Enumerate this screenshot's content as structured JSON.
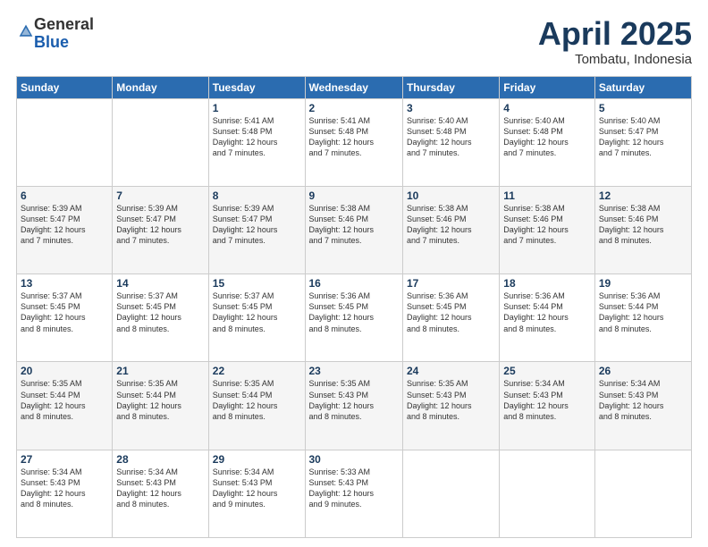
{
  "logo": {
    "general": "General",
    "blue": "Blue"
  },
  "header": {
    "month": "April 2025",
    "location": "Tombatu, Indonesia"
  },
  "weekdays": [
    "Sunday",
    "Monday",
    "Tuesday",
    "Wednesday",
    "Thursday",
    "Friday",
    "Saturday"
  ],
  "weeks": [
    [
      {
        "day": "",
        "detail": ""
      },
      {
        "day": "",
        "detail": ""
      },
      {
        "day": "1",
        "detail": "Sunrise: 5:41 AM\nSunset: 5:48 PM\nDaylight: 12 hours\nand 7 minutes."
      },
      {
        "day": "2",
        "detail": "Sunrise: 5:41 AM\nSunset: 5:48 PM\nDaylight: 12 hours\nand 7 minutes."
      },
      {
        "day": "3",
        "detail": "Sunrise: 5:40 AM\nSunset: 5:48 PM\nDaylight: 12 hours\nand 7 minutes."
      },
      {
        "day": "4",
        "detail": "Sunrise: 5:40 AM\nSunset: 5:48 PM\nDaylight: 12 hours\nand 7 minutes."
      },
      {
        "day": "5",
        "detail": "Sunrise: 5:40 AM\nSunset: 5:47 PM\nDaylight: 12 hours\nand 7 minutes."
      }
    ],
    [
      {
        "day": "6",
        "detail": "Sunrise: 5:39 AM\nSunset: 5:47 PM\nDaylight: 12 hours\nand 7 minutes."
      },
      {
        "day": "7",
        "detail": "Sunrise: 5:39 AM\nSunset: 5:47 PM\nDaylight: 12 hours\nand 7 minutes."
      },
      {
        "day": "8",
        "detail": "Sunrise: 5:39 AM\nSunset: 5:47 PM\nDaylight: 12 hours\nand 7 minutes."
      },
      {
        "day": "9",
        "detail": "Sunrise: 5:38 AM\nSunset: 5:46 PM\nDaylight: 12 hours\nand 7 minutes."
      },
      {
        "day": "10",
        "detail": "Sunrise: 5:38 AM\nSunset: 5:46 PM\nDaylight: 12 hours\nand 7 minutes."
      },
      {
        "day": "11",
        "detail": "Sunrise: 5:38 AM\nSunset: 5:46 PM\nDaylight: 12 hours\nand 7 minutes."
      },
      {
        "day": "12",
        "detail": "Sunrise: 5:38 AM\nSunset: 5:46 PM\nDaylight: 12 hours\nand 8 minutes."
      }
    ],
    [
      {
        "day": "13",
        "detail": "Sunrise: 5:37 AM\nSunset: 5:45 PM\nDaylight: 12 hours\nand 8 minutes."
      },
      {
        "day": "14",
        "detail": "Sunrise: 5:37 AM\nSunset: 5:45 PM\nDaylight: 12 hours\nand 8 minutes."
      },
      {
        "day": "15",
        "detail": "Sunrise: 5:37 AM\nSunset: 5:45 PM\nDaylight: 12 hours\nand 8 minutes."
      },
      {
        "day": "16",
        "detail": "Sunrise: 5:36 AM\nSunset: 5:45 PM\nDaylight: 12 hours\nand 8 minutes."
      },
      {
        "day": "17",
        "detail": "Sunrise: 5:36 AM\nSunset: 5:45 PM\nDaylight: 12 hours\nand 8 minutes."
      },
      {
        "day": "18",
        "detail": "Sunrise: 5:36 AM\nSunset: 5:44 PM\nDaylight: 12 hours\nand 8 minutes."
      },
      {
        "day": "19",
        "detail": "Sunrise: 5:36 AM\nSunset: 5:44 PM\nDaylight: 12 hours\nand 8 minutes."
      }
    ],
    [
      {
        "day": "20",
        "detail": "Sunrise: 5:35 AM\nSunset: 5:44 PM\nDaylight: 12 hours\nand 8 minutes."
      },
      {
        "day": "21",
        "detail": "Sunrise: 5:35 AM\nSunset: 5:44 PM\nDaylight: 12 hours\nand 8 minutes."
      },
      {
        "day": "22",
        "detail": "Sunrise: 5:35 AM\nSunset: 5:44 PM\nDaylight: 12 hours\nand 8 minutes."
      },
      {
        "day": "23",
        "detail": "Sunrise: 5:35 AM\nSunset: 5:43 PM\nDaylight: 12 hours\nand 8 minutes."
      },
      {
        "day": "24",
        "detail": "Sunrise: 5:35 AM\nSunset: 5:43 PM\nDaylight: 12 hours\nand 8 minutes."
      },
      {
        "day": "25",
        "detail": "Sunrise: 5:34 AM\nSunset: 5:43 PM\nDaylight: 12 hours\nand 8 minutes."
      },
      {
        "day": "26",
        "detail": "Sunrise: 5:34 AM\nSunset: 5:43 PM\nDaylight: 12 hours\nand 8 minutes."
      }
    ],
    [
      {
        "day": "27",
        "detail": "Sunrise: 5:34 AM\nSunset: 5:43 PM\nDaylight: 12 hours\nand 8 minutes."
      },
      {
        "day": "28",
        "detail": "Sunrise: 5:34 AM\nSunset: 5:43 PM\nDaylight: 12 hours\nand 8 minutes."
      },
      {
        "day": "29",
        "detail": "Sunrise: 5:34 AM\nSunset: 5:43 PM\nDaylight: 12 hours\nand 9 minutes."
      },
      {
        "day": "30",
        "detail": "Sunrise: 5:33 AM\nSunset: 5:43 PM\nDaylight: 12 hours\nand 9 minutes."
      },
      {
        "day": "",
        "detail": ""
      },
      {
        "day": "",
        "detail": ""
      },
      {
        "day": "",
        "detail": ""
      }
    ]
  ]
}
